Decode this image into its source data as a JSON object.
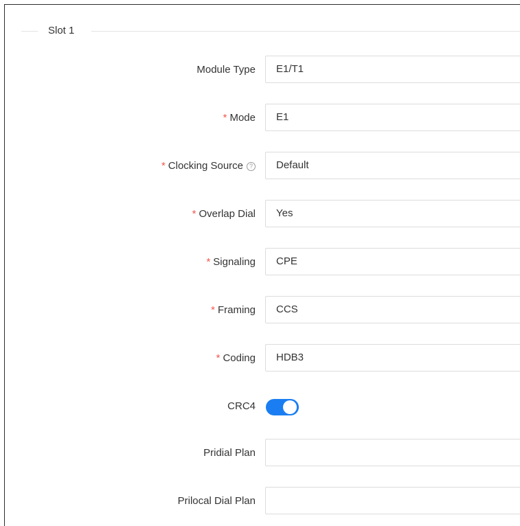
{
  "section": {
    "title": "Slot 1"
  },
  "fields": [
    {
      "label": "Module Type",
      "required": false,
      "value": "E1/T1"
    },
    {
      "label": "Mode",
      "required": true,
      "value": "E1"
    },
    {
      "label": "Clocking Source",
      "required": true,
      "value": "Default",
      "help_icon": "question-circle-icon"
    },
    {
      "label": "Overlap Dial",
      "required": true,
      "value": "Yes"
    },
    {
      "label": "Signaling",
      "required": true,
      "value": "CPE"
    },
    {
      "label": "Framing",
      "required": true,
      "value": "CCS"
    },
    {
      "label": "Coding",
      "required": true,
      "value": "HDB3"
    },
    {
      "label": "CRC4",
      "required": false,
      "type": "toggle",
      "enabled": true
    },
    {
      "label": "Pridial Plan",
      "required": false,
      "value": ""
    },
    {
      "label": "Prilocal Dial Plan",
      "required": false,
      "value": ""
    }
  ],
  "required_marker": "*",
  "colors": {
    "required": "#f5574e",
    "toggle_on": "#1a7ef2",
    "input_border": "#dcdcdc",
    "text": "#333333"
  }
}
